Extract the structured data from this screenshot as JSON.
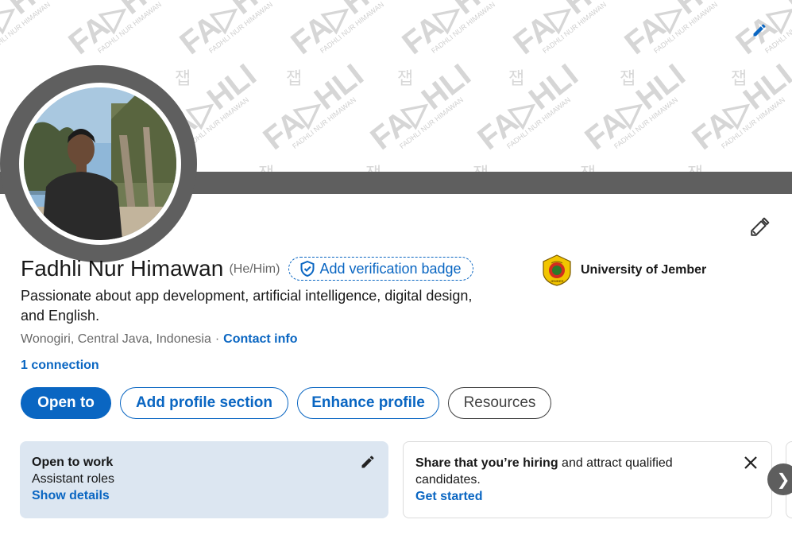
{
  "banner": {
    "watermark_text": "FA▷HLI",
    "watermark_subtext": "FADHLI NUR HIMAWAN",
    "watermark_mark": "잽",
    "edit_icon": "pencil-icon",
    "accent_color": "#0a66c2"
  },
  "profile": {
    "name": "Fadhli Nur Himawan",
    "pronouns": "(He/Him)",
    "verification_label": "Add verification badge",
    "headline": "Passionate about app development, artificial intelligence, digital design, and English.",
    "location": "Wonogiri, Central Java, Indonesia",
    "separator": "·",
    "contact_label": "Contact info",
    "connections_label": "1 connection"
  },
  "education": {
    "name": "University of Jember",
    "logo_text": "JEMBER"
  },
  "actions": {
    "open_to": "Open to",
    "add_section": "Add profile section",
    "enhance": "Enhance profile",
    "resources": "Resources"
  },
  "cards": {
    "open_to_work": {
      "title": "Open to work",
      "subtitle": "Assistant roles",
      "link": "Show details"
    },
    "hiring": {
      "title": "Share that you’re hiring",
      "rest": " and attract qualified candidates.",
      "link": "Get started"
    }
  },
  "carousel": {
    "next_glyph": "❯"
  }
}
